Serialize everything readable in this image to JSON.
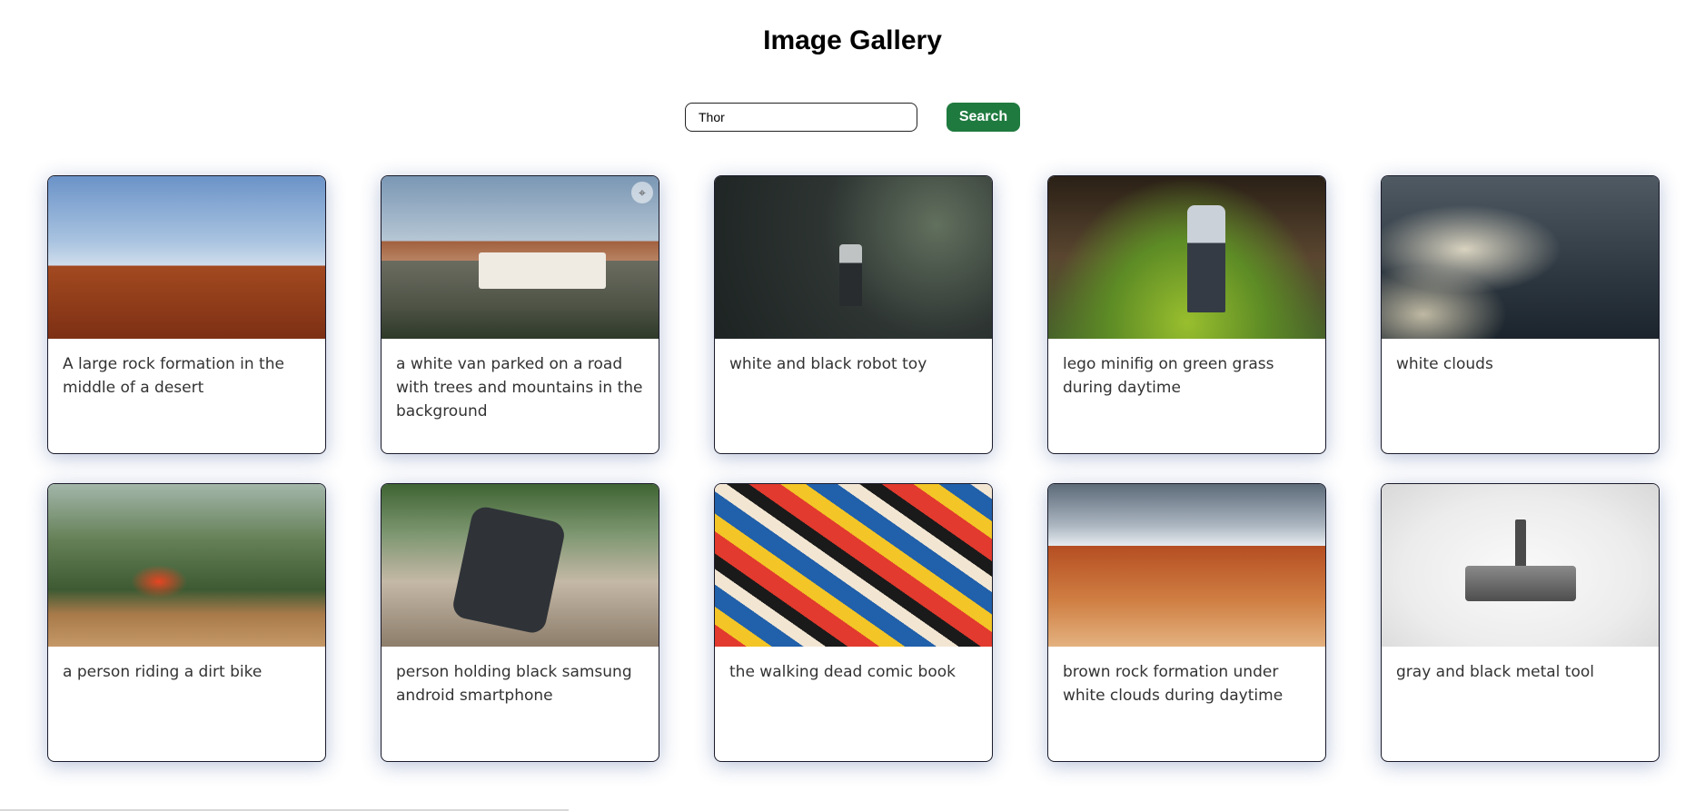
{
  "header": {
    "title": "Image Gallery"
  },
  "search": {
    "value": "Thor",
    "button_label": "Search"
  },
  "accent_color": "#1f7a3f",
  "gallery": {
    "cards": [
      {
        "caption": "A large rock formation in the middle of a desert"
      },
      {
        "caption": "a white van parked on a road with trees and mountains in the background",
        "overlay_icon": "lens-icon"
      },
      {
        "caption": "white and black robot toy"
      },
      {
        "caption": "lego minifig on green grass during daytime"
      },
      {
        "caption": "white clouds"
      },
      {
        "caption": "a person riding a dirt bike"
      },
      {
        "caption": "person holding black samsung android smartphone"
      },
      {
        "caption": "the walking dead comic book"
      },
      {
        "caption": "brown rock formation under white clouds during daytime"
      },
      {
        "caption": "gray and black metal tool"
      }
    ]
  }
}
